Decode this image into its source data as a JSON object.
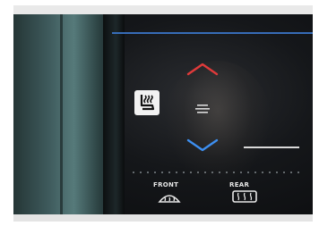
{
  "controls": {
    "front_label": "FRONT",
    "rear_label": "REAR"
  },
  "icons": {
    "seat_heater": "heated-seat-icon",
    "fan": "fan-speed-icon",
    "up": "chevron-up-icon",
    "down": "chevron-down-icon",
    "front_defrost": "front-defrost-icon",
    "rear_defrost": "rear-defrost-icon"
  },
  "colors": {
    "up_arrow": "#e03a3a",
    "down_arrow": "#3d8ff0",
    "panel_glow": "#3d7bd4"
  }
}
